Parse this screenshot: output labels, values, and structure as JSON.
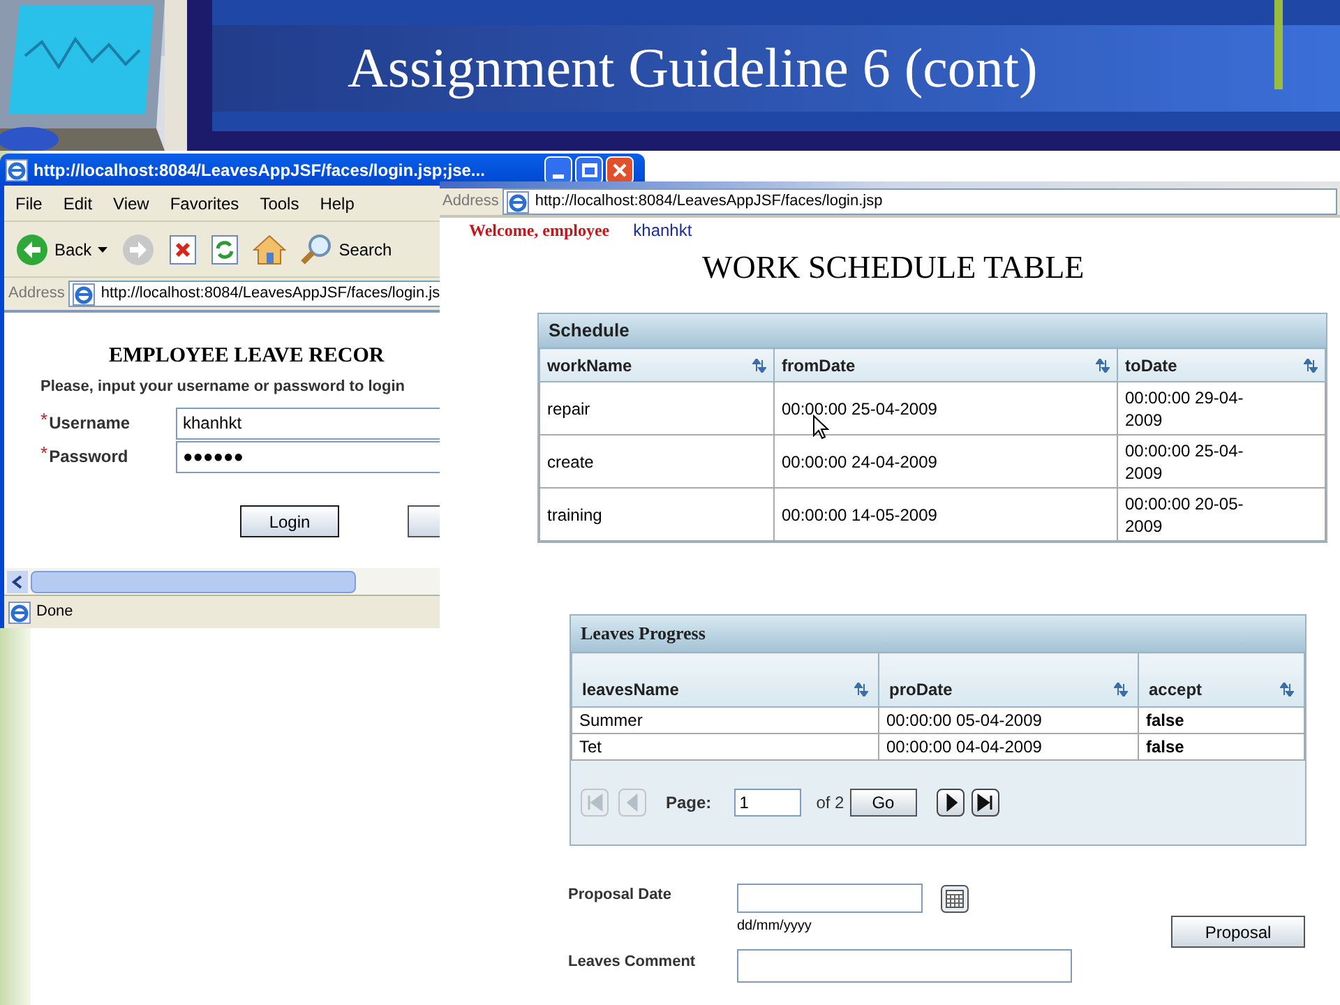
{
  "slide": {
    "title": "Assignment Guideline 6 (cont)"
  },
  "login_window": {
    "title": "http://localhost:8084/LeavesAppJSF/faces/login.jsp;jse...",
    "menu": [
      "File",
      "Edit",
      "View",
      "Favorites",
      "Tools",
      "Help"
    ],
    "toolbar": [
      {
        "kind": "back",
        "label": "Back"
      },
      {
        "kind": "forward"
      },
      {
        "kind": "stop"
      },
      {
        "kind": "refresh"
      },
      {
        "kind": "home"
      },
      {
        "kind": "search",
        "label": "Search"
      }
    ],
    "address_label": "Address",
    "address": "http://localhost:8084/LeavesAppJSF/faces/login.js",
    "heading": "EMPLOYEE LEAVE RECOR",
    "instruction": "Please, input your username or password to login",
    "fields": [
      {
        "mark": "*",
        "label": "Username",
        "value": "khanhkt"
      },
      {
        "mark": "*",
        "label": "Password",
        "value": "●●●●●●"
      }
    ],
    "login_button": "Login",
    "status": "Done"
  },
  "app_window": {
    "address_label": "Address",
    "address": "http://localhost:8084/LeavesAppJSF/faces/login.jsp",
    "welcome": "Welcome, employee",
    "user": "khanhkt",
    "heading": "WORK SCHEDULE TABLE",
    "schedule": {
      "caption": "Schedule",
      "columns": [
        "workName",
        "fromDate",
        "toDate"
      ],
      "rows": [
        [
          "repair",
          "00:00:00 25-04-2009",
          "00:00:00 29-04-2009"
        ],
        [
          "create",
          "00:00:00 24-04-2009",
          "00:00:00 25-04-2009"
        ],
        [
          "training",
          "00:00:00 14-05-2009",
          "00:00:00 20-05-2009"
        ]
      ]
    },
    "leaves": {
      "caption": "Leaves Progress",
      "columns": [
        "leavesName",
        "proDate",
        "accept"
      ],
      "rows": [
        [
          "Summer",
          "00:00:00 05-04-2009",
          "false"
        ],
        [
          "Tet",
          "00:00:00 04-04-2009",
          "false"
        ]
      ],
      "pager": {
        "buttons": [
          {
            "kind": "first",
            "disabled": true
          },
          {
            "kind": "prev",
            "disabled": true
          },
          {
            "kind": "next",
            "disabled": false
          },
          {
            "kind": "last",
            "disabled": false
          }
        ],
        "page_label": "Page:",
        "page": "1",
        "total": "of 2",
        "go": "Go"
      }
    },
    "form": {
      "date_label": "Proposal Date",
      "date_hint": "dd/mm/yyyy",
      "comment_label": "Leaves Comment",
      "button": "Proposal"
    }
  }
}
